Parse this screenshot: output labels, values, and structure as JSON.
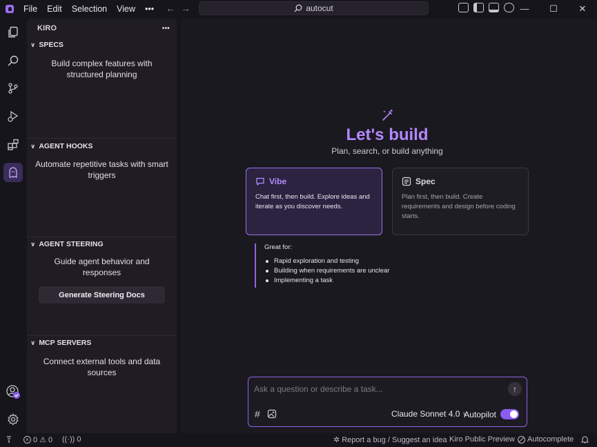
{
  "menu": [
    "File",
    "Edit",
    "Selection",
    "View"
  ],
  "command_center": {
    "text": "autocut"
  },
  "sidebar": {
    "title": "KIRO",
    "sections": [
      {
        "title": "SPECS",
        "description": "Build complex features with structured planning"
      },
      {
        "title": "AGENT HOOKS",
        "description": "Automate repetitive tasks with smart triggers"
      },
      {
        "title": "AGENT STEERING",
        "description": "Guide agent behavior and responses",
        "button": "Generate Steering Docs"
      },
      {
        "title": "MCP SERVERS",
        "description": "Connect external tools and data sources"
      }
    ]
  },
  "main": {
    "title": "Let's build",
    "subtitle": "Plan, search, or build anything",
    "modes": {
      "vibe": {
        "title": "Vibe",
        "description": "Chat first, then build. Explore ideas and iterate as you discover needs."
      },
      "spec": {
        "title": "Spec",
        "description": "Plan first, then build. Create requirements and design before coding starts."
      }
    },
    "great_for": {
      "title": "Great for:",
      "items": [
        "Rapid exploration and testing",
        "Building when requirements are unclear",
        "Implementing a task"
      ]
    }
  },
  "chat": {
    "placeholder": "Ask a question or describe a task...",
    "model": "Claude Sonnet 4.0",
    "autopilot_label": "Autopilot",
    "autopilot_on": true
  },
  "status": {
    "errors": "0",
    "warnings": "0",
    "ports": "0",
    "report": "Report a bug / Suggest an idea",
    "preview": "Kiro Public Preview",
    "autocomplete": "Autocomplete"
  },
  "colors": {
    "accent": "#9b6ff5",
    "title": "#b388ff"
  }
}
